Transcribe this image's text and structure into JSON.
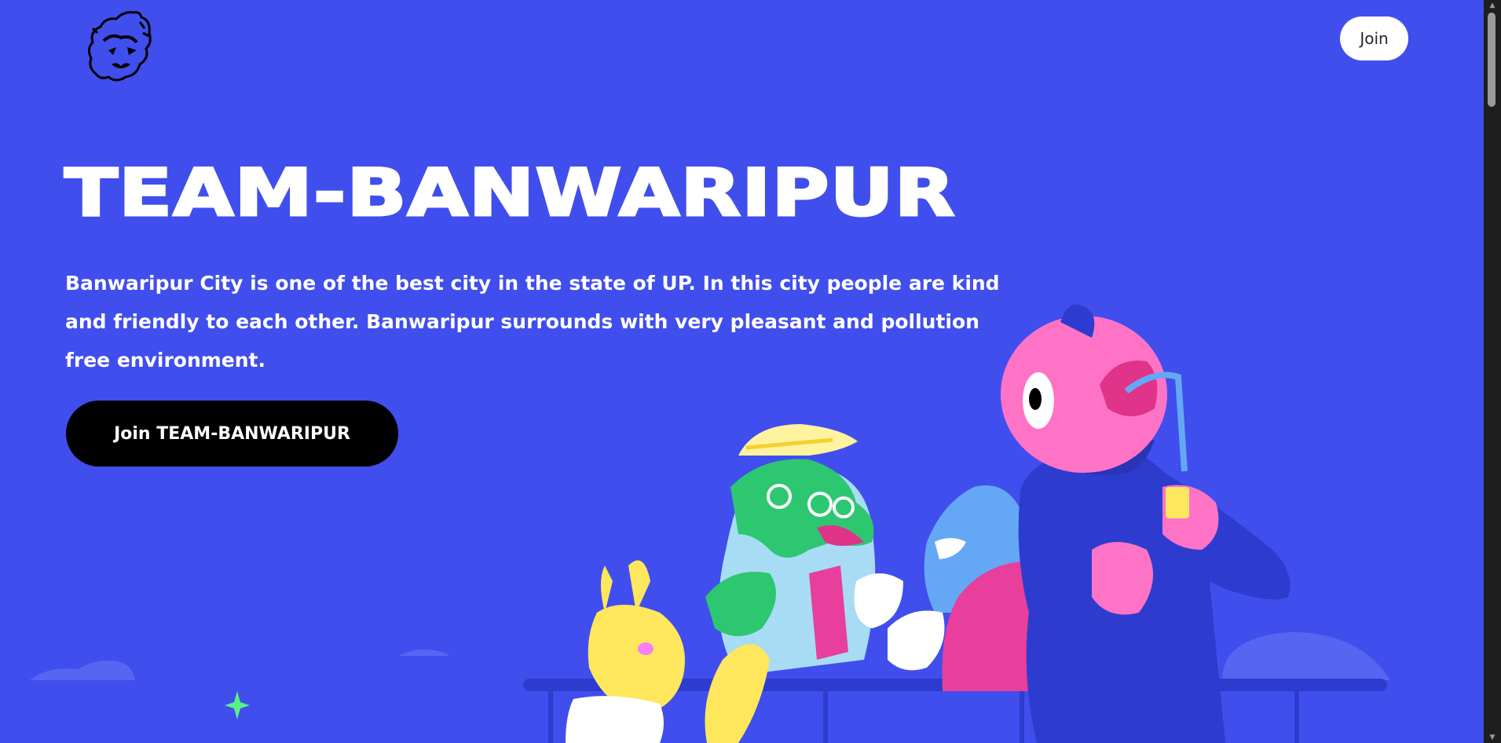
{
  "header": {
    "logo_name": "tiger-logo",
    "join_label": "Join"
  },
  "hero": {
    "title": "TEAM-BANWARIPUR",
    "description": "Banwaripur City is one of the best city in the state of UP. In this city people are kind and friendly to each other. Banwaripur surrounds with very pleasant and pollution free environment.",
    "cta_label": "Join TEAM-BANWARIPUR"
  },
  "colors": {
    "background": "#404eed",
    "cta_background": "#000000",
    "join_background": "#ffffff",
    "text": "#ffffff"
  },
  "scrollbar": {
    "up_arrow": "▲",
    "down_arrow": "▼"
  }
}
